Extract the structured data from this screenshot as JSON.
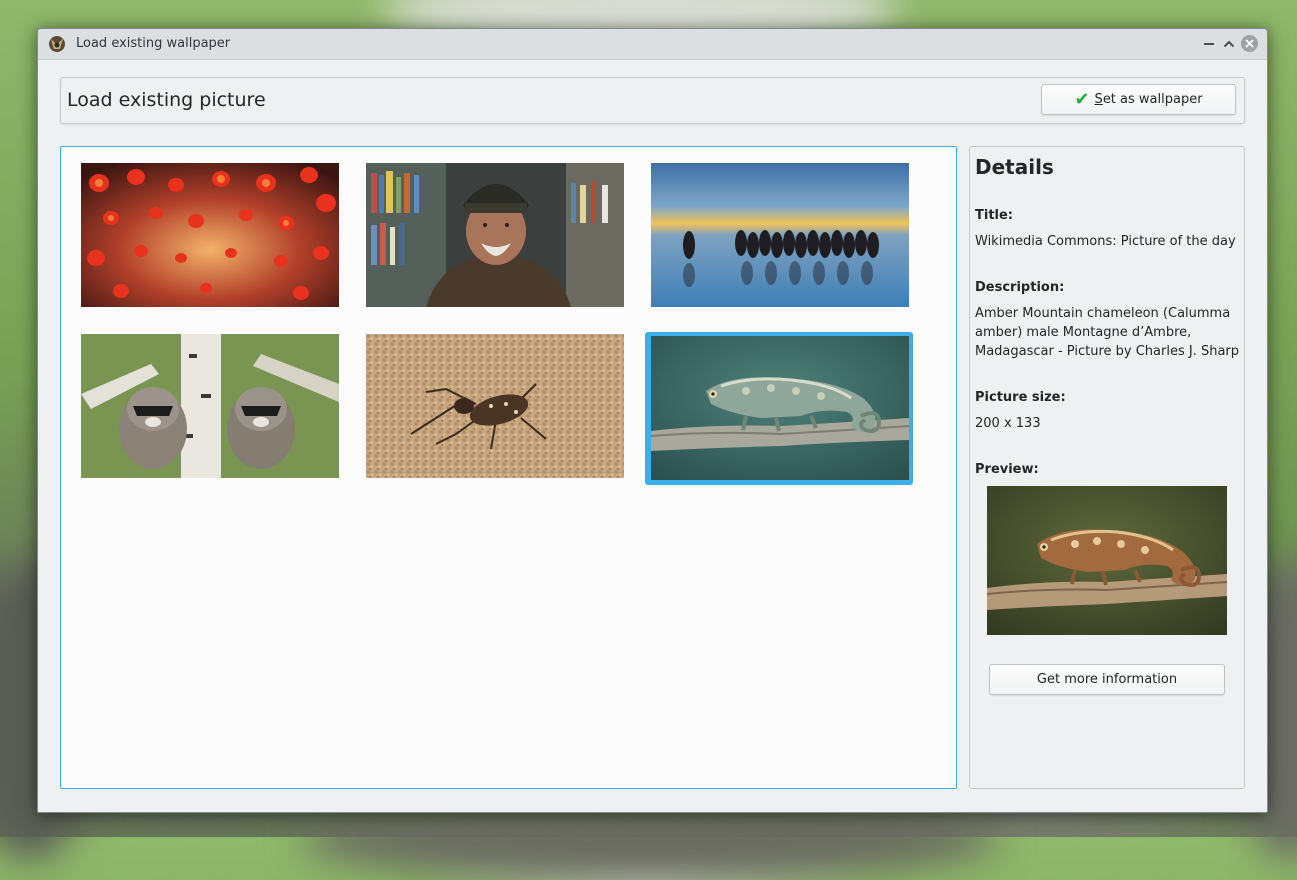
{
  "window": {
    "title": "Load existing wallpaper",
    "minimize_icon": "minimize-icon",
    "maximize_icon": "maximize-icon",
    "close_icon": "close-icon"
  },
  "header": {
    "title": "Load existing picture",
    "set_button_label": "Set as wallpaper",
    "set_button_mnemonic": "S",
    "set_button_rest": "et as wallpaper",
    "set_button_icon": "checkmark-icon"
  },
  "grid": {
    "selected_index": 5,
    "items": [
      {
        "subject": "red-lanterns"
      },
      {
        "subject": "elderly-man-in-hat"
      },
      {
        "subject": "penguins-on-beach"
      },
      {
        "subject": "raccoons-in-tree"
      },
      {
        "subject": "beetle-on-sand"
      },
      {
        "subject": "chameleon-on-branch"
      }
    ]
  },
  "details": {
    "heading": "Details",
    "title_label": "Title:",
    "title_value": "Wikimedia Commons: Picture of the day",
    "description_label": "Description:",
    "description_value": "Amber Mountain chameleon (Calumma amber) male Montagne d’Ambre, Madagascar - Picture by Charles J. Sharp",
    "size_label": "Picture size:",
    "size_value": "200 x 133",
    "preview_label": "Preview:",
    "more_button_label": "Get more information"
  },
  "colors": {
    "selection": "#3daee9",
    "check": "#27ae3f",
    "window_bg": "#eff0f1"
  }
}
